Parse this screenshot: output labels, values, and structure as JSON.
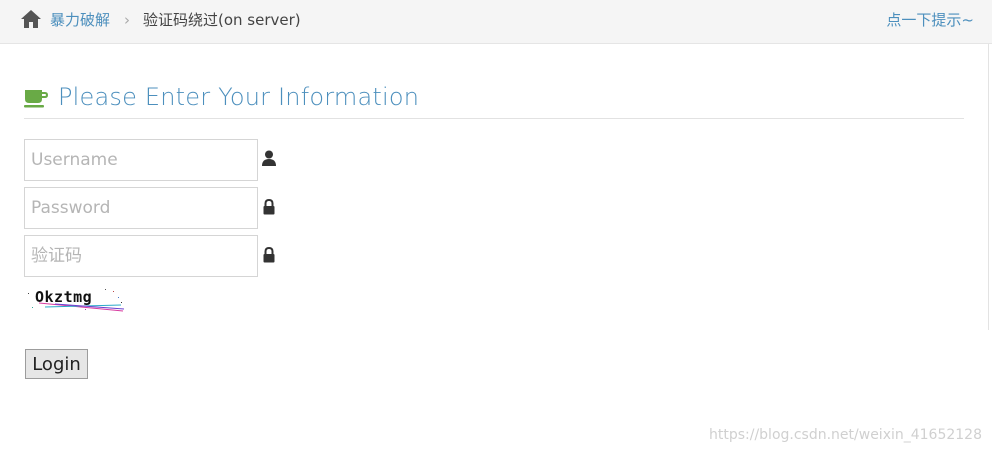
{
  "breadcrumb": {
    "home_icon": "home-icon",
    "parent": "暴力破解",
    "separator": "›",
    "current": "验证码绕过(on server)"
  },
  "hint_link": "点一下提示~",
  "form": {
    "heading_icon": "coffee-cup-icon",
    "heading": "Please Enter Your Information",
    "username_placeholder": "Username",
    "username_icon": "user-icon",
    "password_placeholder": "Password",
    "password_icon": "lock-icon",
    "captcha_placeholder": "验证码",
    "captcha_icon": "lock-icon",
    "captcha_text": "Okztmg",
    "login_label": "Login"
  },
  "watermark": "https://blog.csdn.net/weixin_41652128",
  "colors": {
    "link": "#4c8fbd",
    "cup": "#69aa46",
    "topbar_bg": "#f5f5f5"
  }
}
